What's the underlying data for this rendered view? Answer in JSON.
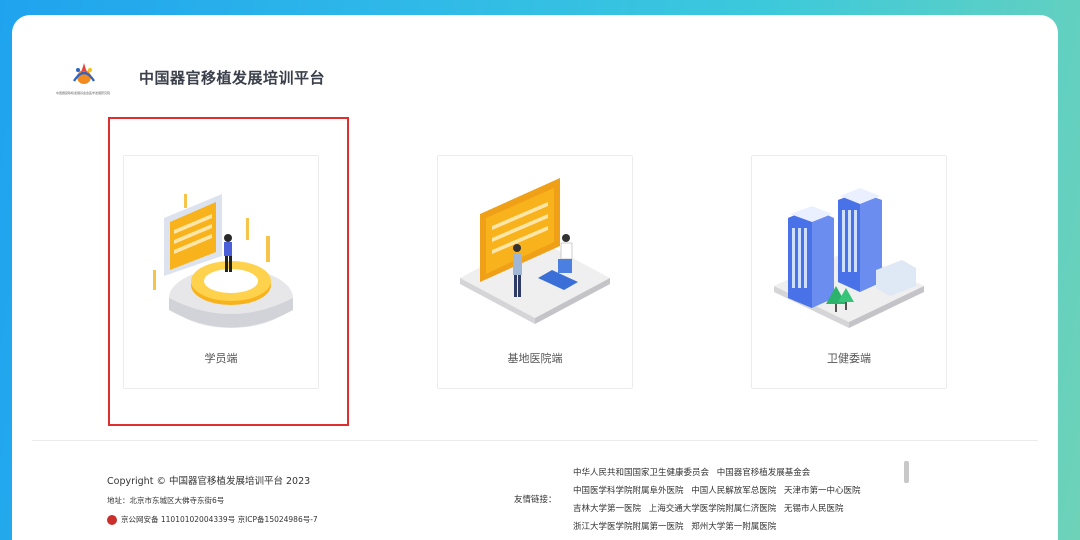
{
  "header": {
    "logo_subtitle": "中国器官移植发展基金会医学发展研究院",
    "title": "中国器官移植发展培训平台"
  },
  "tiles": [
    {
      "label": "学员端",
      "icon": "student-illustration",
      "selected": true
    },
    {
      "label": "基地医院端",
      "icon": "hospital-base-illustration",
      "selected": false
    },
    {
      "label": "卫健委端",
      "icon": "health-commission-building-illustration",
      "selected": false
    }
  ],
  "footer": {
    "copyright": "Copyright  ©  中国器官移植发展培训平台 2023",
    "address": "地址：北京市东城区大佛寺东街6号",
    "beian": "京公网安备 11010102004339号 京ICP备15024986号-7",
    "friend_links_label": "友情链接：",
    "friend_links": [
      [
        "中华人民共和国国家卫生健康委员会",
        "中国器官移植发展基金会"
      ],
      [
        "中国医学科学院附属阜外医院",
        "中国人民解放军总医院",
        "天津市第一中心医院"
      ],
      [
        "吉林大学第一医院",
        "上海交通大学医学院附属仁济医院",
        "无锡市人民医院"
      ],
      [
        "浙江大学医学院附属第一医院",
        "郑州大学第一附属医院"
      ]
    ]
  },
  "colors": {
    "selected_border": "#e02d2d",
    "accent_yellow": "#f7b21c",
    "building_blue": "#4a72e8"
  }
}
